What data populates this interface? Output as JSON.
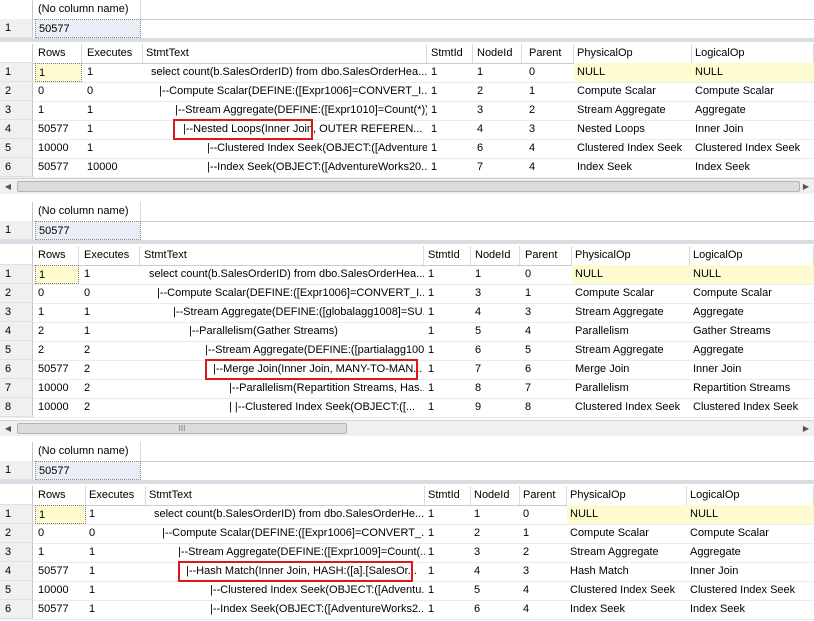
{
  "no_column_name_header": "(No column name)",
  "count_row": {
    "rownum": "1",
    "value": "50577"
  },
  "headers1": [
    "Rows",
    "Executes",
    "StmtText",
    "StmtId",
    "NodeId",
    "Parent",
    "PhysicalOp",
    "LogicalOp"
  ],
  "headers2": [
    "Rows",
    "Executes",
    "StmtText",
    "StmtId",
    "NodeId",
    "Parent",
    "PhysicalOp",
    "LogicalOp"
  ],
  "headers3": [
    "Rows",
    "Executes",
    "StmtText",
    "StmtId",
    "NodeId",
    "Parent",
    "PhysicalOp",
    "LogicalOp"
  ],
  "plan1": [
    [
      "1",
      "1",
      "1",
      "select count(b.SalesOrderID)  from dbo.SalesOrderHea...",
      "1",
      "1",
      "0",
      "NULL",
      "NULL"
    ],
    [
      "2",
      "0",
      "0",
      "|--Compute Scalar(DEFINE:([Expr1006]=CONVERT_I...",
      "1",
      "2",
      "1",
      "Compute Scalar",
      "Compute Scalar"
    ],
    [
      "3",
      "1",
      "1",
      "|--Stream Aggregate(DEFINE:([Expr1010]=Count(*)))",
      "1",
      "3",
      "2",
      "Stream Aggregate",
      "Aggregate"
    ],
    [
      "4",
      "50577",
      "1",
      "|--Nested Loops(Inner Join, OUTER REFEREN...",
      "1",
      "4",
      "3",
      "Nested Loops",
      "Inner Join"
    ],
    [
      "5",
      "10000",
      "1",
      "|--Clustered Index Seek(OBJECT:([Adventure...",
      "1",
      "6",
      "4",
      "Clustered Index Seek",
      "Clustered Index Seek"
    ],
    [
      "6",
      "50577",
      "10000",
      "|--Index Seek(OBJECT:([AdventureWorks20...",
      "1",
      "7",
      "4",
      "Index Seek",
      "Index Seek"
    ]
  ],
  "plan2": [
    [
      "1",
      "1",
      "1",
      "select count(b.SalesOrderID)  from dbo.SalesOrderHea...",
      "1",
      "1",
      "0",
      "NULL",
      "NULL"
    ],
    [
      "2",
      "0",
      "0",
      "|--Compute Scalar(DEFINE:([Expr1006]=CONVERT_I...",
      "1",
      "3",
      "1",
      "Compute Scalar",
      "Compute Scalar"
    ],
    [
      "3",
      "1",
      "1",
      "|--Stream Aggregate(DEFINE:([globalagg1008]=SU...",
      "1",
      "4",
      "3",
      "Stream Aggregate",
      "Aggregate"
    ],
    [
      "4",
      "2",
      "1",
      "|--Parallelism(Gather Streams)",
      "1",
      "5",
      "4",
      "Parallelism",
      "Gather Streams"
    ],
    [
      "5",
      "2",
      "2",
      "|--Stream Aggregate(DEFINE:([partialagg100...",
      "1",
      "6",
      "5",
      "Stream Aggregate",
      "Aggregate"
    ],
    [
      "6",
      "50577",
      "2",
      "|--Merge Join(Inner Join, MANY-TO-MAN...",
      "1",
      "7",
      "6",
      "Merge Join",
      "Inner Join"
    ],
    [
      "7",
      "10000",
      "2",
      "|--Parallelism(Repartition Streams, Has...",
      "1",
      "8",
      "7",
      "Parallelism",
      "Repartition Streams"
    ],
    [
      "8",
      "10000",
      "2",
      "|    |--Clustered Index Seek(OBJECT:([...",
      "1",
      "9",
      "8",
      "Clustered Index Seek",
      "Clustered Index Seek"
    ]
  ],
  "plan3": [
    [
      "1",
      "1",
      "1",
      "select count(b.SalesOrderID)  from dbo.SalesOrderHe...",
      "1",
      "1",
      "0",
      "NULL",
      "NULL"
    ],
    [
      "2",
      "0",
      "0",
      "|--Compute Scalar(DEFINE:([Expr1006]=CONVERT_...",
      "1",
      "2",
      "1",
      "Compute Scalar",
      "Compute Scalar"
    ],
    [
      "3",
      "1",
      "1",
      "|--Stream Aggregate(DEFINE:([Expr1009]=Count(...",
      "1",
      "3",
      "2",
      "Stream Aggregate",
      "Aggregate"
    ],
    [
      "4",
      "50577",
      "1",
      "|--Hash Match(Inner Join, HASH:([a].[SalesOr...",
      "1",
      "4",
      "3",
      "Hash Match",
      "Inner Join"
    ],
    [
      "5",
      "10000",
      "1",
      "|--Clustered Index Seek(OBJECT:([Adventu...",
      "1",
      "5",
      "4",
      "Clustered Index Seek",
      "Clustered Index Seek"
    ],
    [
      "6",
      "50577",
      "1",
      "|--Index Seek(OBJECT:([AdventureWorks2...",
      "1",
      "6",
      "4",
      "Index Seek",
      "Index Seek"
    ]
  ],
  "scroll": {
    "left_icon": "left-arrow-icon",
    "right_icon": "right-arrow-icon",
    "thumb_grip": "III"
  },
  "colors": {
    "highlight_box": "#e0161a",
    "selected_cell": "#fffbd0",
    "row_header": "#f0f0f0"
  }
}
